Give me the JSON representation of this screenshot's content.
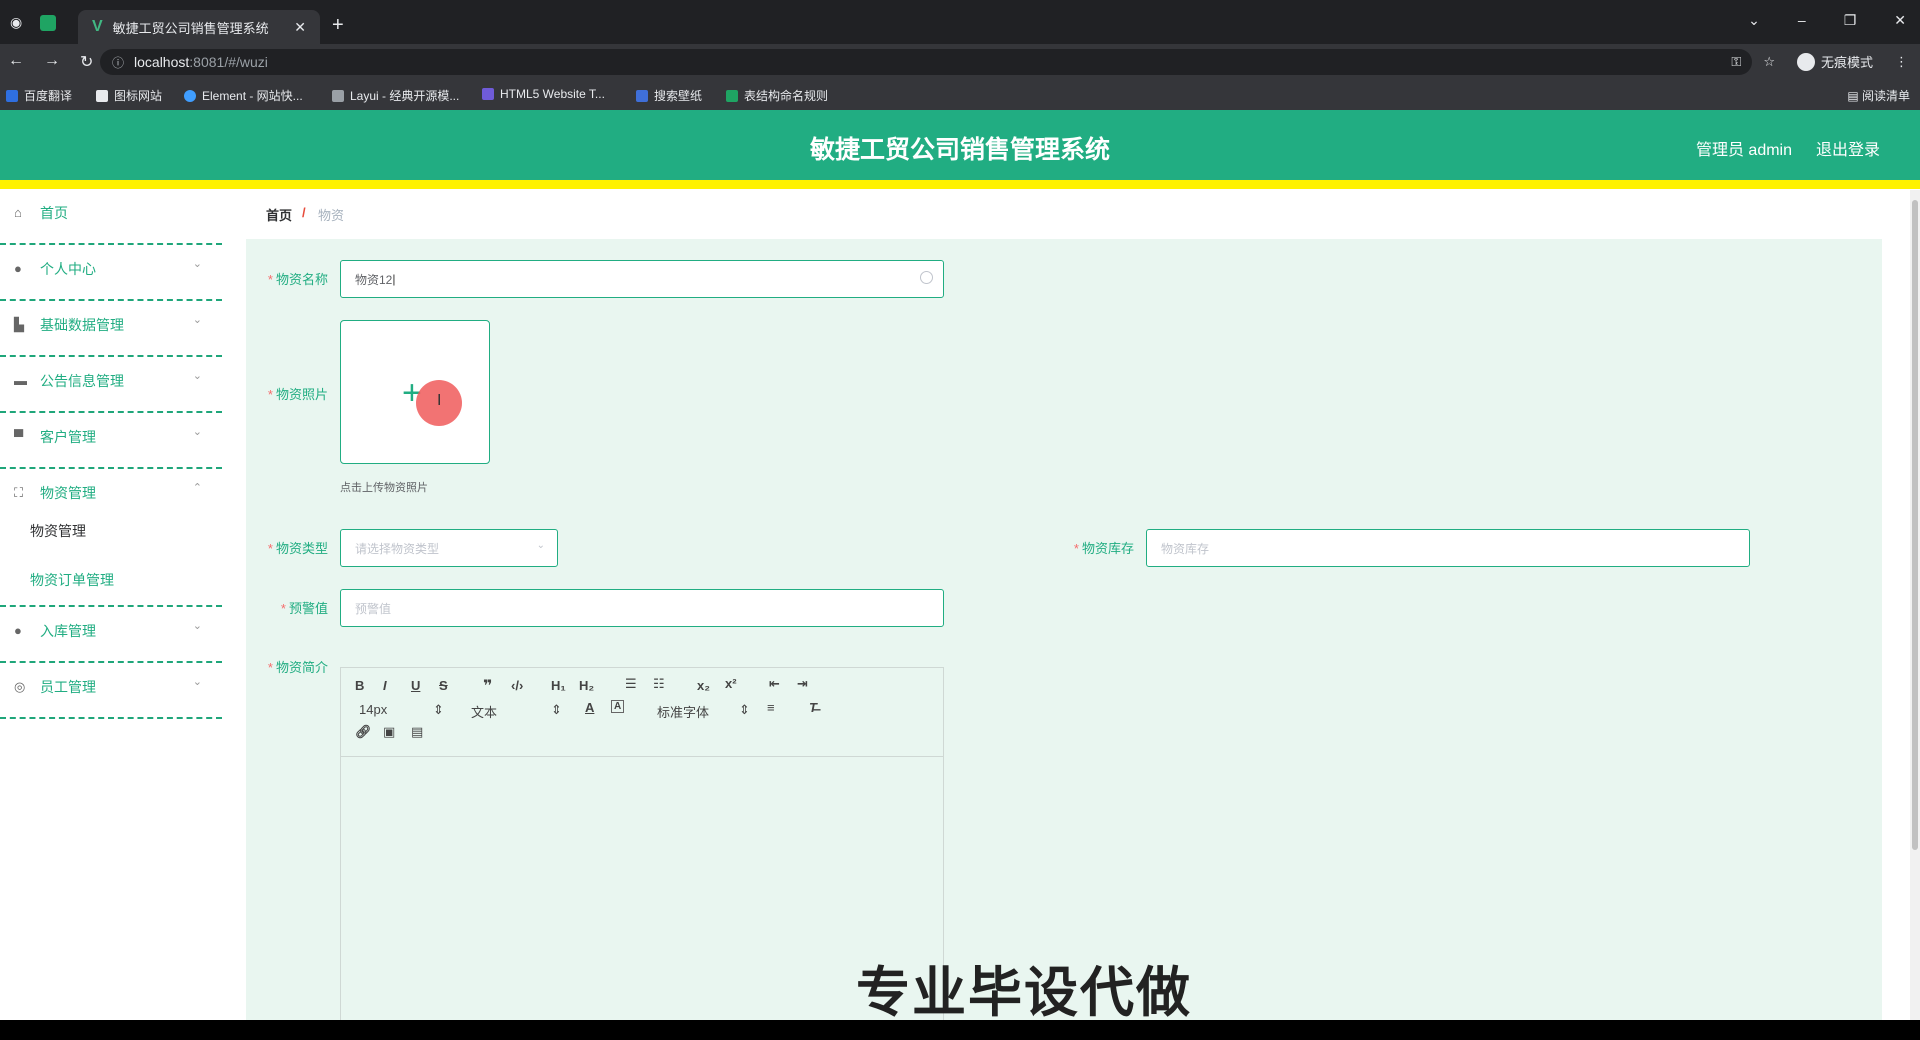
{
  "browser": {
    "tab_title": "敏捷工贸公司销售管理系统",
    "new_tab": "+",
    "url_host": "localhost",
    "url_path": ":8081/#/wuzi",
    "incognito_label": "无痕模式",
    "reading_list": "阅读清单",
    "bookmarks": [
      "百度翻译",
      "图标网站",
      "Element - 网站快...",
      "Layui - 经典开源模...",
      "HTML5 Website T...",
      "搜索壁纸",
      "表结构命名规则"
    ]
  },
  "header": {
    "title": "敏捷工贸公司销售管理系统",
    "user": "管理员 admin",
    "logout": "退出登录"
  },
  "sidebar": {
    "items": [
      {
        "label": "首页",
        "icon": "home-icon"
      },
      {
        "label": "个人中心",
        "icon": "user-icon"
      },
      {
        "label": "基础数据管理",
        "icon": "data-icon"
      },
      {
        "label": "公告信息管理",
        "icon": "notice-icon"
      },
      {
        "label": "客户管理",
        "icon": "customer-icon"
      },
      {
        "label": "物资管理",
        "icon": "material-icon"
      },
      {
        "label": "入库管理",
        "icon": "location-icon"
      },
      {
        "label": "员工管理",
        "icon": "staff-icon"
      }
    ],
    "sub_items": [
      "物资管理",
      "物资订单管理"
    ]
  },
  "breadcrumb": {
    "home": "首页",
    "separator": "/",
    "current": "物资"
  },
  "form": {
    "name_label": "物资名称",
    "name_value": "物资12",
    "photo_label": "物资照片",
    "photo_tip": "点击上传物资照片",
    "type_label": "物资类型",
    "type_placeholder": "请选择物资类型",
    "stock_label": "物资库存",
    "stock_placeholder": "物资库存",
    "warn_label": "预警值",
    "warn_placeholder": "预警值",
    "intro_label": "物资简介",
    "required_mark": "*"
  },
  "editor": {
    "font_size": "14px",
    "format": "文本",
    "font_family": "标准字体"
  },
  "overlay_text": "专业毕设代做",
  "colors": {
    "accent": "#21ad82",
    "header_stripe": "#fff200",
    "required": "#f56c6c"
  }
}
